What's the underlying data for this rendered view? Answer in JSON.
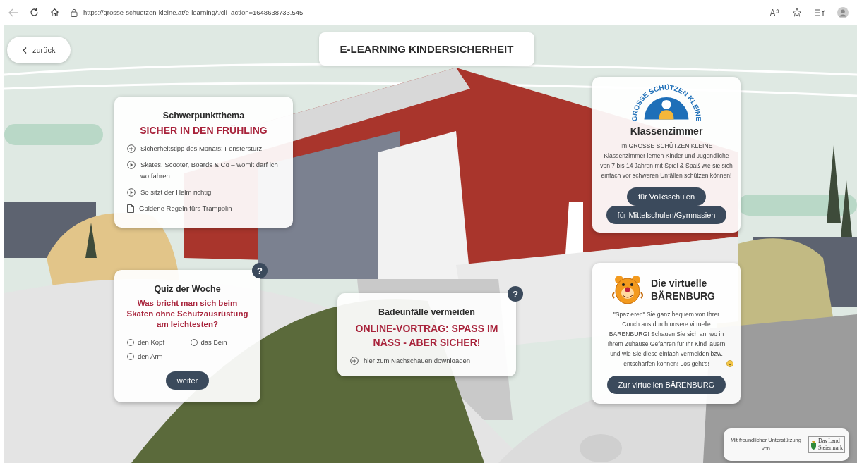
{
  "browser": {
    "url": "https://grosse-schuetzen-kleine.at/e-learning/?cli_action=1648638733.545"
  },
  "back_button": {
    "label": "zurück"
  },
  "page_title": "E-LEARNING KINDERSICHERHEIT",
  "topic": {
    "heading": "Schwerpunktthema",
    "title": "SICHER IN DEN FRÜHLING",
    "items": [
      {
        "kind": "plus",
        "text": "Sicherheitstipp des Monats: Fenstersturz"
      },
      {
        "kind": "play",
        "text": "Skates, Scooter, Boards & Co – womit darf ich wo fahren"
      },
      {
        "kind": "play",
        "text": "So sitzt der Helm richtig"
      },
      {
        "kind": "document",
        "text": "Goldene Regeln fürs Trampolin"
      }
    ]
  },
  "quiz": {
    "help": "?",
    "heading": "Quiz der Woche",
    "question": "Was bricht man sich beim Skaten ohne Schutzausrüstung am leichtesten?",
    "options": [
      {
        "label": "den Kopf",
        "selected": false
      },
      {
        "label": "das Bein",
        "selected": false
      },
      {
        "label": "den Arm",
        "selected": false
      }
    ],
    "button": "weiter"
  },
  "talk": {
    "help": "?",
    "heading": "Badeunfälle vermeiden",
    "title": "ONLINE-VORTRAG: SPASS IM NASS - ABER SICHER!",
    "items": [
      {
        "kind": "plus",
        "text": "hier zum Nachschauen downloaden"
      }
    ]
  },
  "classroom": {
    "logo_text": "GROSSE SCHÜTZEN KLEINE",
    "title": "Klassenzimmer",
    "text": "Im GROSSE SCHÜTZEN KLEINE Klassenzimmer lernen Kinder und Jugendliche von 7 bis 14 Jahren mit Spiel & Spaß wie sie sich einfach vor schweren Unfällen schützen können!",
    "buttons": [
      "für Volksschulen",
      "für Mittelschulen/Gymnasien"
    ]
  },
  "bear": {
    "title": "Die virtuelle BÄRENBURG",
    "text": "\"Spazieren\" Sie ganz bequem von Ihrer Couch aus durch unsere virtuelle BÄRENBURG! Schauen Sie sich an, wo in Ihrem Zuhause Gefahren für Ihr Kind lauern und wie Sie diese einfach vermeiden bzw. entschärfen können! Los geht's!",
    "button": "Zur virtuellen BÄRENBURG"
  },
  "sponsor": {
    "text": "Mit freundlicher Unterstützung von",
    "logo_lines": [
      "Das Land",
      "Steiermark"
    ]
  }
}
